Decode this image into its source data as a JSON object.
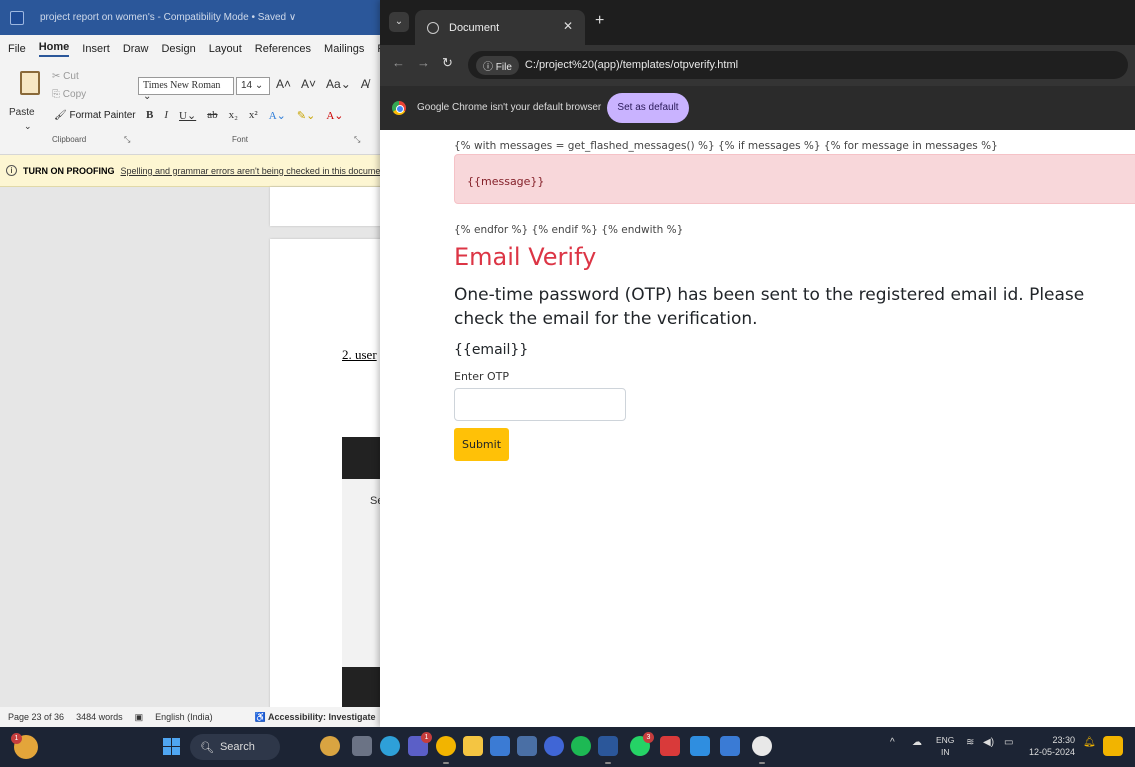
{
  "word": {
    "title": "project report on women's  -  Compatibility Mode • Saved ∨",
    "menu": [
      "File",
      "Home",
      "Insert",
      "Draw",
      "Design",
      "Layout",
      "References",
      "Mailings",
      "R"
    ],
    "clipboard": {
      "paste": "Paste",
      "cut": "Cut",
      "copy": "Copy",
      "format_painter": "Format Painter",
      "group_label": "Clipboard"
    },
    "font": {
      "family": "Times New Roman",
      "size": "14",
      "group_label": "Font"
    },
    "notice": {
      "label": "TURN ON PROOFING",
      "text": "Spelling and grammar errors aren't being checked in this docume"
    },
    "page_text": "2. user",
    "embed_text": "Se",
    "status": {
      "page": "Page 23 of 36",
      "words": "3484 words",
      "lang": "English (India)",
      "access": "Accessibility: Investigate"
    }
  },
  "chrome": {
    "tab_title": "Document",
    "file_chip": "File",
    "url": "C:/project%20(app)/templates/otpverify.html",
    "infobar_msg": "Google Chrome isn't your default browser",
    "infobar_btn": "Set as default"
  },
  "page": {
    "jinja_top": "{% with messages = get_flashed_messages() %} {% if messages %} {% for message in messages %}",
    "alert_text": "{{message}}",
    "jinja_end": "{% endfor %} {% endif %} {% endwith %}",
    "heading": "Email Verify",
    "message": "One-time password (OTP) has been sent to the registered email id. Please check the email for the verification.",
    "email_var": "{{email}}",
    "otp_label": "Enter OTP",
    "otp_value": "",
    "submit_label": "Submit"
  },
  "taskbar": {
    "search_label": "Search",
    "lang_top": "ENG",
    "lang_bottom": "IN",
    "time": "23:30",
    "date": "12-05-2024",
    "badges": {
      "widget": "1",
      "teams": "1",
      "whatsapp": "3"
    }
  },
  "colors": {
    "word_blue": "#2b579a",
    "danger": "#dc3545",
    "warning": "#ffc107",
    "alert_bg": "#f8d7da"
  }
}
